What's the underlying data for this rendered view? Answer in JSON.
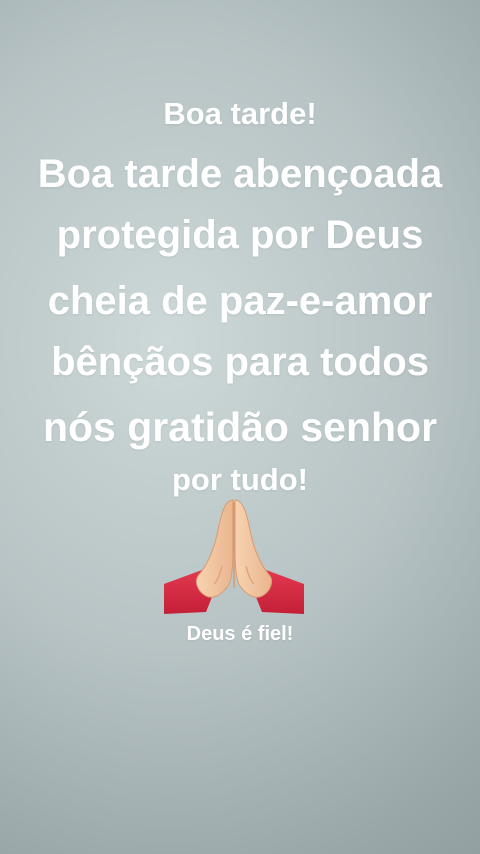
{
  "story": {
    "greeting": "Boa tarde!",
    "message_lines": [
      "Boa tarde abençoada",
      "protegida por Deus",
      "cheia de paz-e-amor",
      "bênçãos para todos",
      "nós gratidão senhor"
    ],
    "closing": "por tudo!",
    "emoji": "folded-hands-icon",
    "faith_line": "Deus é fiel!"
  }
}
